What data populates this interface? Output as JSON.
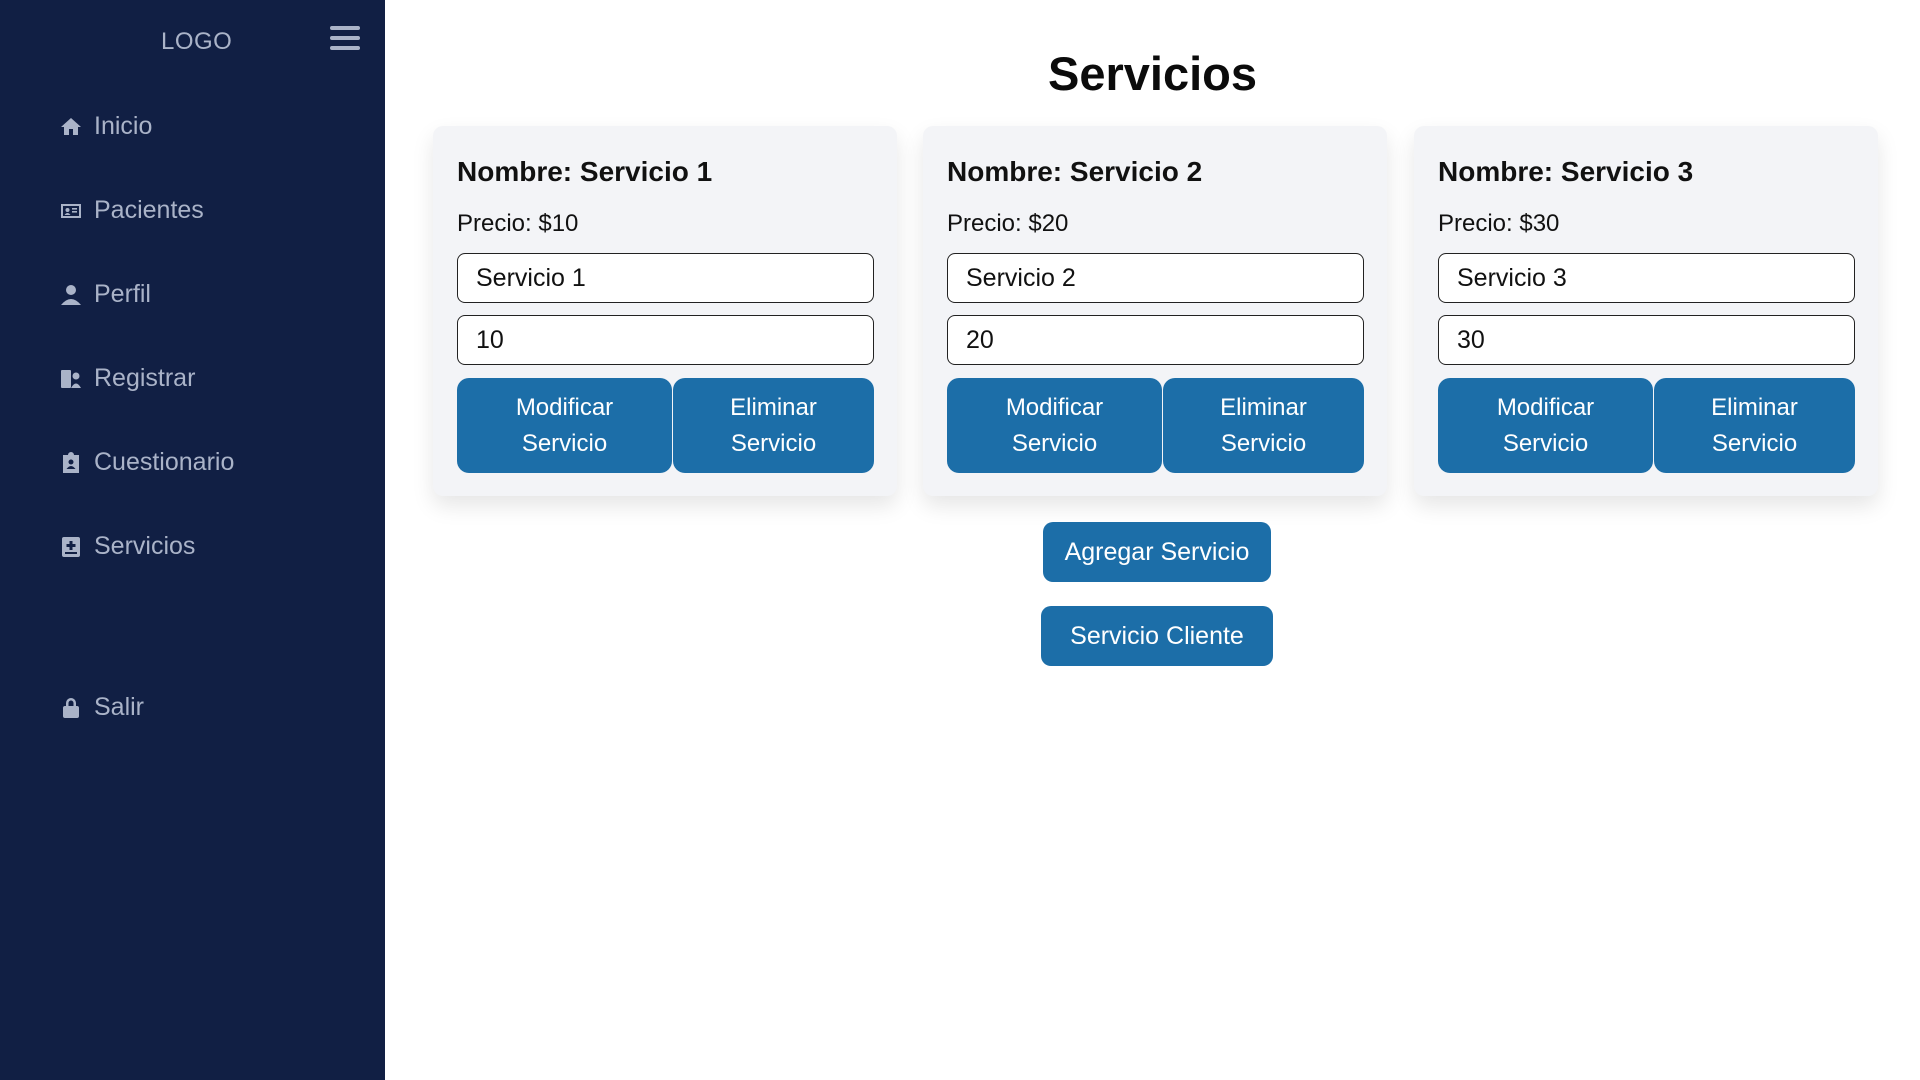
{
  "sidebar": {
    "logo": "LOGO",
    "items": [
      {
        "label": "Inicio",
        "icon": "home-icon"
      },
      {
        "label": "Pacientes",
        "icon": "id-card-icon"
      },
      {
        "label": "Perfil",
        "icon": "user-icon"
      },
      {
        "label": "Registrar",
        "icon": "user-register-icon"
      },
      {
        "label": "Cuestionario",
        "icon": "clipboard-icon"
      },
      {
        "label": "Servicios",
        "icon": "medical-plus-icon"
      }
    ],
    "logout": {
      "label": "Salir",
      "icon": "lock-icon"
    }
  },
  "main": {
    "title": "Servicios",
    "services": [
      {
        "name": "Nombre: Servicio 1",
        "price": "Precio: $10",
        "name_value": "Servicio 1",
        "price_value": "10",
        "modify_label": "Modificar Servicio",
        "delete_label": "Eliminar Servicio"
      },
      {
        "name": "Nombre: Servicio 2",
        "price": "Precio: $20",
        "name_value": "Servicio 2",
        "price_value": "20",
        "modify_label": "Modificar Servicio",
        "delete_label": "Eliminar Servicio"
      },
      {
        "name": "Nombre: Servicio 3",
        "price": "Precio: $30",
        "name_value": "Servicio 3",
        "price_value": "30",
        "modify_label": "Modificar Servicio",
        "delete_label": "Eliminar Servicio"
      }
    ],
    "add_label": "Agregar Servicio",
    "client_label": "Servicio Cliente"
  },
  "colors": {
    "sidebar_bg": "#111f44",
    "sidebar_text": "#aab3c8",
    "accent": "#1c6ea8",
    "card_bg": "#f3f4f7"
  }
}
